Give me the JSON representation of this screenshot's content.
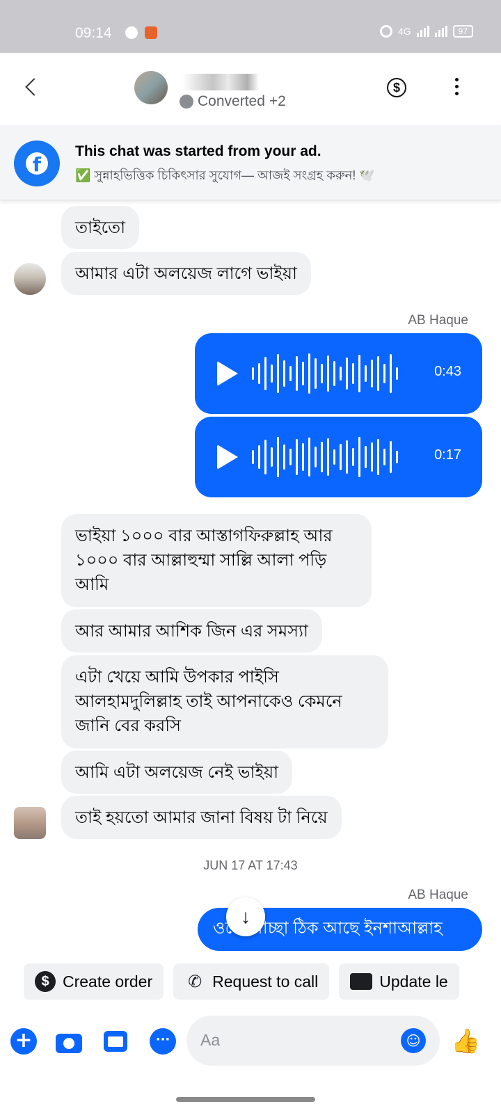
{
  "status_bar": {
    "time": "09:14",
    "net": "4G",
    "battery": "97"
  },
  "header": {
    "contact_status": "Converted",
    "extra_count": "+2"
  },
  "ad_banner": {
    "title": "This chat was started from your ad.",
    "subtitle": "✅ সুন্নাহভিত্তিক চিকিৎসার সুযোগ— আজই সংগ্রহ করুন! 🕊️"
  },
  "messages": {
    "m1": "তাইতো",
    "m2": "আমার এটা অলয়েজ লাগে ভাইয়া",
    "sender_1": "AB Haque",
    "voice_1_duration": "0:43",
    "voice_2_duration": "0:17",
    "m3": "ভাইয়া ১০০০ বার আস্তাগফিরুল্লাহ আর ১০০০ বার আল্লাহুম্মা সাল্লি আলা পড়ি আমি",
    "m4": "আর আমার আশিক জিন এর সমস্যা",
    "m5": "এটা খেয়ে আমি উপকার পাইসি আলহামদুলিল্লাহ তাই আপনাকেও কেমনে জানি বের করসি",
    "m6": "আমি এটা অলয়েজ নেই ভাইয়া",
    "m7": "তাই হয়তো আমার জানা বিষয় টা নিয়ে",
    "timestamp": "JUN 17 AT 17:43",
    "sender_2": "AB Haque",
    "m8": "ওকে আচ্ছা ঠিক আছে ইনশাআল্লাহ"
  },
  "chips": {
    "create_order": "Create order",
    "request_call": "Request to call",
    "update_lead": "Update le"
  },
  "composer": {
    "placeholder": "Aa"
  },
  "colors": {
    "accent": "#0a66ff",
    "bubble_in": "#f0f1f3",
    "fb_blue": "#1877f2"
  },
  "icons": [
    "back-arrow-icon",
    "dollar-icon",
    "more-vert-icon",
    "facebook-logo-icon",
    "play-icon",
    "arrow-down-icon",
    "phone-plus-icon",
    "id-card-icon",
    "plus-icon",
    "camera-icon",
    "gallery-icon",
    "chat-more-icon",
    "emoji-icon",
    "thumbs-up-icon"
  ]
}
